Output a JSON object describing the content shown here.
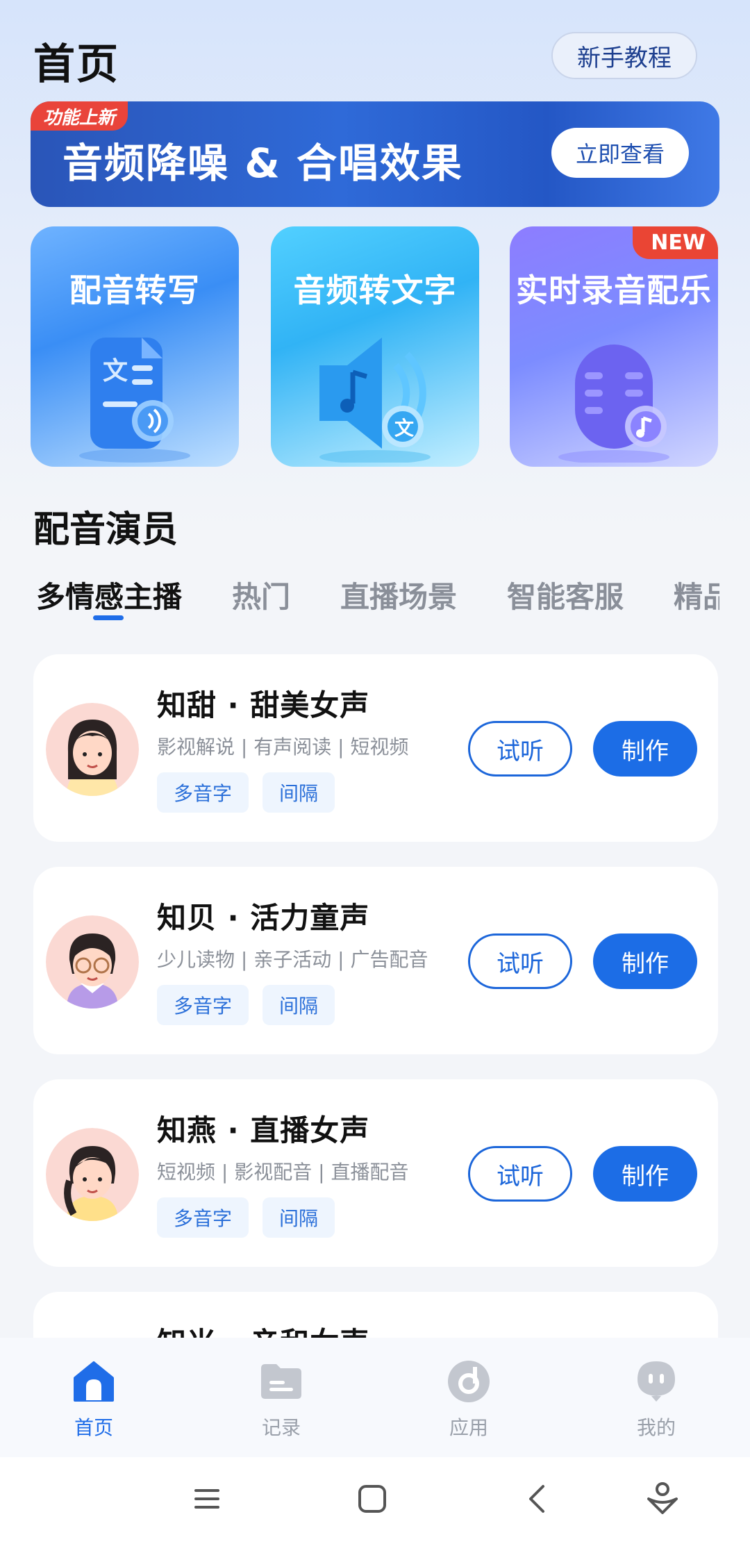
{
  "header": {
    "title": "首页",
    "tutorial_label": "新手教程"
  },
  "banner": {
    "tag": "功能上新",
    "title": "音频降噪 & 合唱效果",
    "button_label": "立即查看"
  },
  "features": [
    {
      "title": "配音转写",
      "icon": "document-audio-icon"
    },
    {
      "title": "音频转文字",
      "icon": "speaker-text-icon"
    },
    {
      "title": "实时录音配乐",
      "icon": "microphone-music-icon",
      "badge": "NEW"
    }
  ],
  "voice_section": {
    "title": "配音演员",
    "tabs": [
      "多情感主播",
      "热门",
      "直播场景",
      "智能客服",
      "精品"
    ],
    "active_tab": 0
  },
  "voices": [
    {
      "name": "知甜 · 甜美女声",
      "desc": "影视解说 | 有声阅读 | 短视频",
      "tags": [
        "多音字",
        "间隔"
      ],
      "listen": "试听",
      "make": "制作"
    },
    {
      "name": "知贝 · 活力童声",
      "desc": "少儿读物 | 亲子活动 | 广告配音",
      "tags": [
        "多音字",
        "间隔"
      ],
      "listen": "试听",
      "make": "制作"
    },
    {
      "name": "知燕 · 直播女声",
      "desc": "短视频 | 影视配音 | 直播配音",
      "tags": [
        "多音字",
        "间隔"
      ],
      "listen": "试听",
      "make": "制作"
    },
    {
      "name": "知米 · 亲和女声"
    }
  ],
  "bottom_nav": [
    {
      "label": "首页",
      "icon": "home-icon",
      "active": true
    },
    {
      "label": "记录",
      "icon": "folder-icon",
      "active": false
    },
    {
      "label": "应用",
      "icon": "app-disc-icon",
      "active": false
    },
    {
      "label": "我的",
      "icon": "profile-icon",
      "active": false
    }
  ],
  "colors": {
    "accent": "#1c6de6",
    "badge_red": "#e9443a",
    "banner_blue": "#2f6ad8"
  }
}
